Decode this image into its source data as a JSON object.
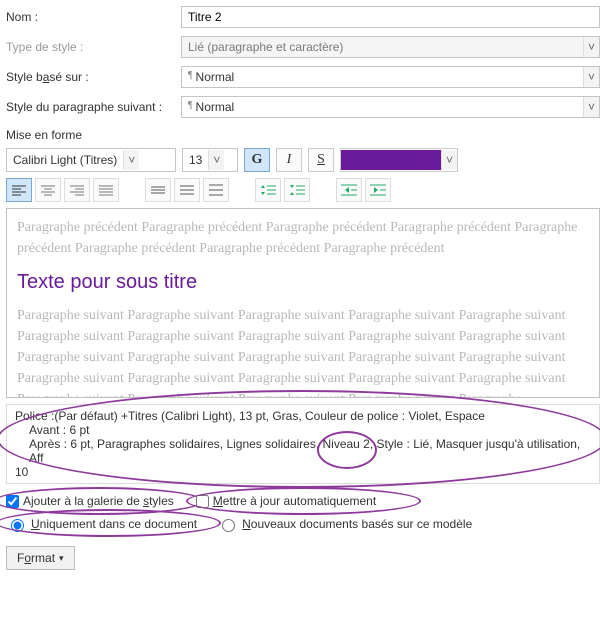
{
  "labels": {
    "name": "Nom :",
    "styleType": "Type de style :",
    "basedOn": "Style basé sur :",
    "nextPara": "Style du paragraphe suivant :",
    "formatSection": "Mise en forme"
  },
  "fields": {
    "name": "Titre 2",
    "styleType": "Lié (paragraphe et caractère)",
    "basedOn": "Normal",
    "nextPara": "Normal"
  },
  "font": {
    "name": "Calibri Light (Titres)",
    "size": "13"
  },
  "btns": {
    "bold": "G",
    "italic": "I",
    "underline": "S"
  },
  "preview": {
    "prev": "Paragraphe précédent Paragraphe précédent Paragraphe précédent Paragraphe précédent Paragraphe précédent Paragraphe précédent Paragraphe précédent Paragraphe précédent",
    "sample": "Texte pour sous titre",
    "next": "Paragraphe suivant Paragraphe suivant Paragraphe suivant Paragraphe suivant Paragraphe suivant Paragraphe suivant Paragraphe suivant Paragraphe suivant Paragraphe suivant Paragraphe suivant Paragraphe suivant Paragraphe suivant Paragraphe suivant Paragraphe suivant Paragraphe suivant Paragraphe suivant Paragraphe suivant Paragraphe suivant Paragraphe suivant Paragraphe suivant Paragraphe suivant Paragraphe suivant Paragraphe suivant Paragraphe suivant Paragraphe"
  },
  "description": {
    "line1": "Police :(Par défaut) +Titres (Calibri Light), 13 pt, Gras, Couleur de police : Violet, Espace",
    "line2": "Avant : 6 pt",
    "line3": "Après : 6 pt, Paragraphes solidaires, Lignes solidaires, Niveau 2, Style : Lié, Masquer jusqu'à utilisation, Aff",
    "line4": "10"
  },
  "checks": {
    "addToGallery": "Ajouter à la galerie de styles",
    "autoUpdate": "Mettre à jour automatiquement"
  },
  "radios": {
    "onlyDoc": "Uniquement dans ce document",
    "newDocs": "Nouveaux documents basés sur ce modèle"
  },
  "formatBtn": "Format",
  "colors": {
    "accent": "#6a1b9a",
    "annotation": "#8e3a9c"
  },
  "underlineChars": {
    "basedOn": "a",
    "addGallery": "s",
    "autoUpdate": "M",
    "onlyDoc": "U",
    "newDocs": "N",
    "formatBtn": "o"
  }
}
